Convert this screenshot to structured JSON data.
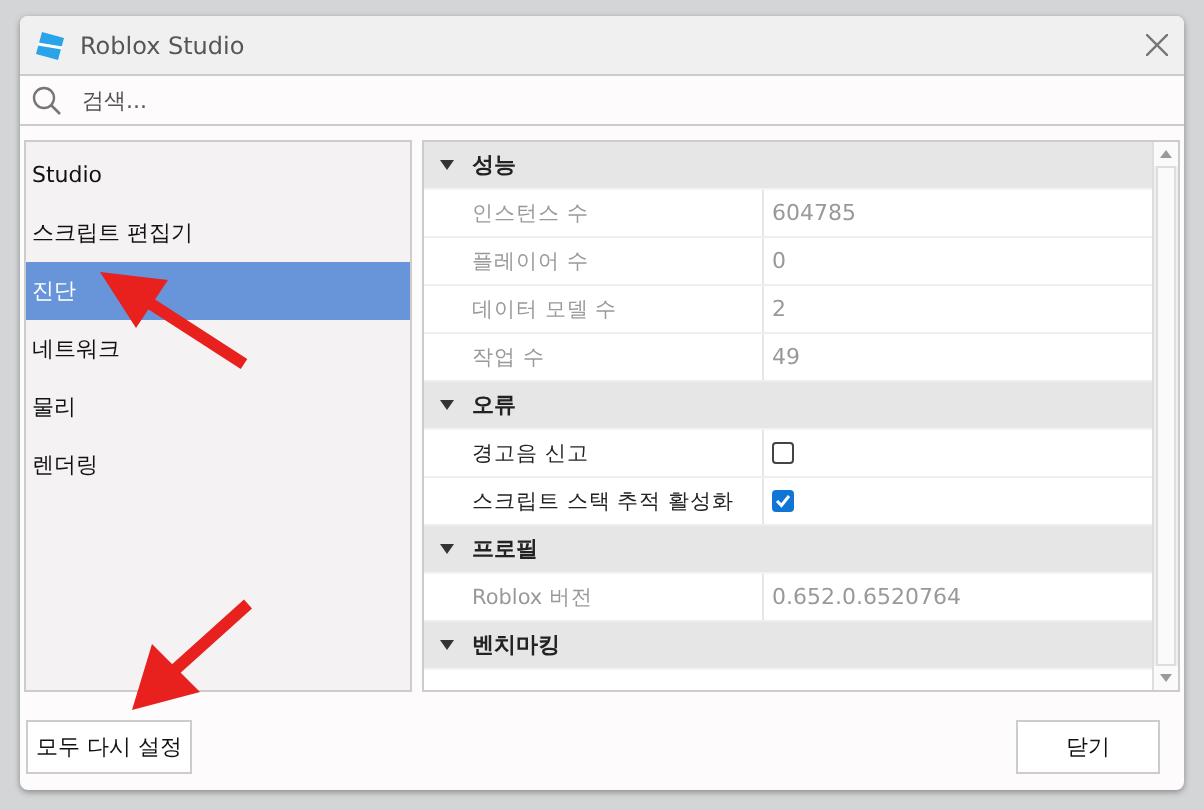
{
  "window": {
    "title": "Roblox Studio"
  },
  "search": {
    "placeholder": "검색..."
  },
  "sidebar": {
    "items": [
      {
        "label": "Studio",
        "selected": false
      },
      {
        "label": "스크립트 편집기",
        "selected": false
      },
      {
        "label": "진단",
        "selected": true
      },
      {
        "label": "네트워크",
        "selected": false
      },
      {
        "label": "물리",
        "selected": false
      },
      {
        "label": "렌더링",
        "selected": false
      }
    ]
  },
  "sections": [
    {
      "title": "성능",
      "expanded": true,
      "rows": [
        {
          "kind": "text",
          "name": "인스턴스 수",
          "value": "604785",
          "disabled": true
        },
        {
          "kind": "text",
          "name": "플레이어 수",
          "value": "0",
          "disabled": true
        },
        {
          "kind": "text",
          "name": "데이터 모델 수",
          "value": "2",
          "disabled": true
        },
        {
          "kind": "text",
          "name": "작업 수",
          "value": "49",
          "disabled": true
        }
      ]
    },
    {
      "title": "오류",
      "expanded": true,
      "rows": [
        {
          "kind": "checkbox",
          "name": "경고음 신고",
          "checked": false,
          "disabled": false
        },
        {
          "kind": "checkbox",
          "name": "스크립트 스택 추적 활성화",
          "checked": true,
          "disabled": false
        }
      ]
    },
    {
      "title": "프로필",
      "expanded": true,
      "rows": [
        {
          "kind": "text",
          "name": "Roblox 버전",
          "value": "0.652.0.6520764",
          "disabled": true
        }
      ]
    },
    {
      "title": "벤치마킹",
      "expanded": true
    }
  ],
  "buttons": {
    "reset": "모두 다시 설정",
    "close": "닫기"
  }
}
